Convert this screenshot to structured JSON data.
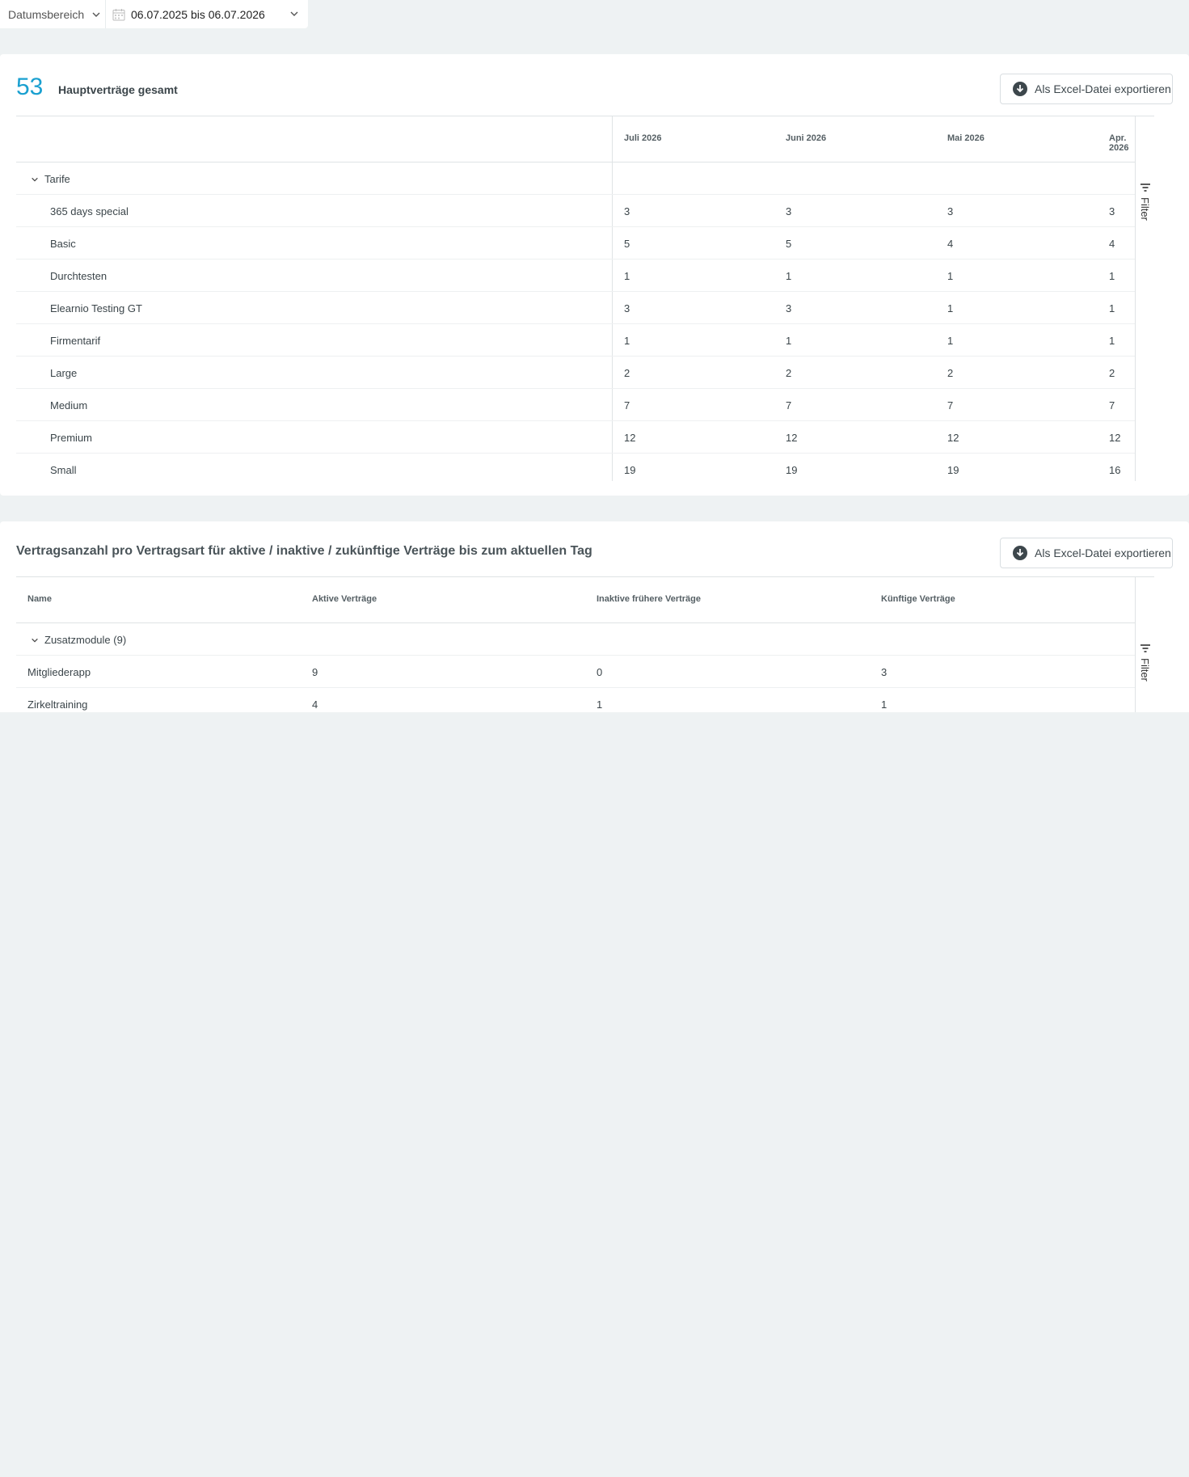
{
  "filterbar": {
    "range_label": "Datumsbereich",
    "date_value": "06.07.2025 bis 06.07.2026"
  },
  "card1": {
    "total": "53",
    "total_label": "Hauptverträge gesamt",
    "export_label": "Als Excel-Datei exportieren",
    "filter_label": "Filter",
    "months": [
      "Juli 2026",
      "Juni 2026",
      "Mai 2026",
      "Apr. 2026"
    ],
    "group": "Tarife",
    "rows": [
      {
        "name": "365 days special",
        "values": [
          "3",
          "3",
          "3",
          "3"
        ]
      },
      {
        "name": "Basic",
        "values": [
          "5",
          "5",
          "4",
          "4"
        ]
      },
      {
        "name": "Durchtesten",
        "values": [
          "1",
          "1",
          "1",
          "1"
        ]
      },
      {
        "name": "Elearnio Testing GT",
        "values": [
          "3",
          "3",
          "1",
          "1"
        ]
      },
      {
        "name": "Firmentarif",
        "values": [
          "1",
          "1",
          "1",
          "1"
        ]
      },
      {
        "name": "Large",
        "values": [
          "2",
          "2",
          "2",
          "2"
        ]
      },
      {
        "name": "Medium",
        "values": [
          "7",
          "7",
          "7",
          "7"
        ]
      },
      {
        "name": "Premium",
        "values": [
          "12",
          "12",
          "12",
          "12"
        ]
      },
      {
        "name": "Small",
        "values": [
          "19",
          "19",
          "19",
          "16"
        ]
      }
    ]
  },
  "card2": {
    "title": "Vertragsanzahl pro Vertragsart für aktive / inaktive / zukünftige Verträge bis zum aktuellen Tag",
    "export_label": "Als Excel-Datei exportieren",
    "filter_label": "Filter",
    "columns": [
      "Name",
      "Aktive Verträge",
      "Inaktive frühere Verträge",
      "Künftige Verträge"
    ],
    "group": "Zusatzmodule (9)",
    "rows": [
      {
        "name": "Mitgliederapp",
        "values": [
          "9",
          "0",
          "3"
        ]
      },
      {
        "name": "Zirkeltraining",
        "values": [
          "4",
          "1",
          "1"
        ]
      }
    ]
  }
}
